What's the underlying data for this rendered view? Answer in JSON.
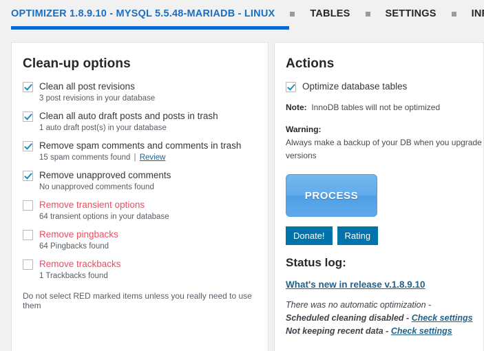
{
  "nav": {
    "active_tab": "OPTIMIZER 1.8.9.10 - MYSQL 5.5.48-MARIADB - LINUX",
    "tabs": [
      "TABLES",
      "SETTINGS",
      "INFO"
    ],
    "active_color": "#1b6ec2",
    "underline_color": "#0a68d2"
  },
  "cleanup": {
    "title": "Clean-up options",
    "options": [
      {
        "label": "Clean all post revisions",
        "checked": true,
        "red": false,
        "sub": "3 post revisions in your database",
        "link": ""
      },
      {
        "label": "Clean all auto draft posts and posts in trash",
        "checked": true,
        "red": false,
        "sub": "1 auto draft post(s) in your database",
        "link": ""
      },
      {
        "label": "Remove spam comments and comments in trash",
        "checked": true,
        "red": false,
        "sub": "15 spam comments found",
        "link": "Review"
      },
      {
        "label": "Remove unapproved comments",
        "checked": true,
        "red": false,
        "sub": "No unapproved comments found",
        "link": ""
      },
      {
        "label": "Remove transient options",
        "checked": false,
        "red": true,
        "sub": "64 transient options in your database",
        "link": ""
      },
      {
        "label": "Remove pingbacks",
        "checked": false,
        "red": true,
        "sub": "64 Pingbacks found",
        "link": ""
      },
      {
        "label": "Remove trackbacks",
        "checked": false,
        "red": true,
        "sub": "1 Trackbacks found",
        "link": ""
      }
    ],
    "footer_note": "Do not select RED marked items unless you really need to use them",
    "red_color": "#ef4b63"
  },
  "actions": {
    "title": "Actions",
    "optimize_label": "Optimize database tables",
    "optimize_checked": true,
    "note_label": "Note:",
    "note_text": "InnoDB tables will not be optimized",
    "warning_label": "Warning:",
    "warning_text": "Always make a backup of your DB when you upgrade to new versions",
    "process_button": "PROCESS",
    "donate_button": "Donate!",
    "rating_button": "Rating",
    "process_color": "#61abeb",
    "minor_button_color": "#0073aa"
  },
  "status": {
    "title": "Status log:",
    "release_link": "What's new in release v.1.8.9.10",
    "lines": [
      {
        "text": "There was no automatic optimization -",
        "bold": false,
        "link": ""
      },
      {
        "text": "Scheduled cleaning disabled - ",
        "bold": true,
        "link": "Check settings"
      },
      {
        "text": "Not keeping recent data - ",
        "bold": true,
        "link": "Check settings"
      }
    ],
    "link_color": "#21618c"
  }
}
